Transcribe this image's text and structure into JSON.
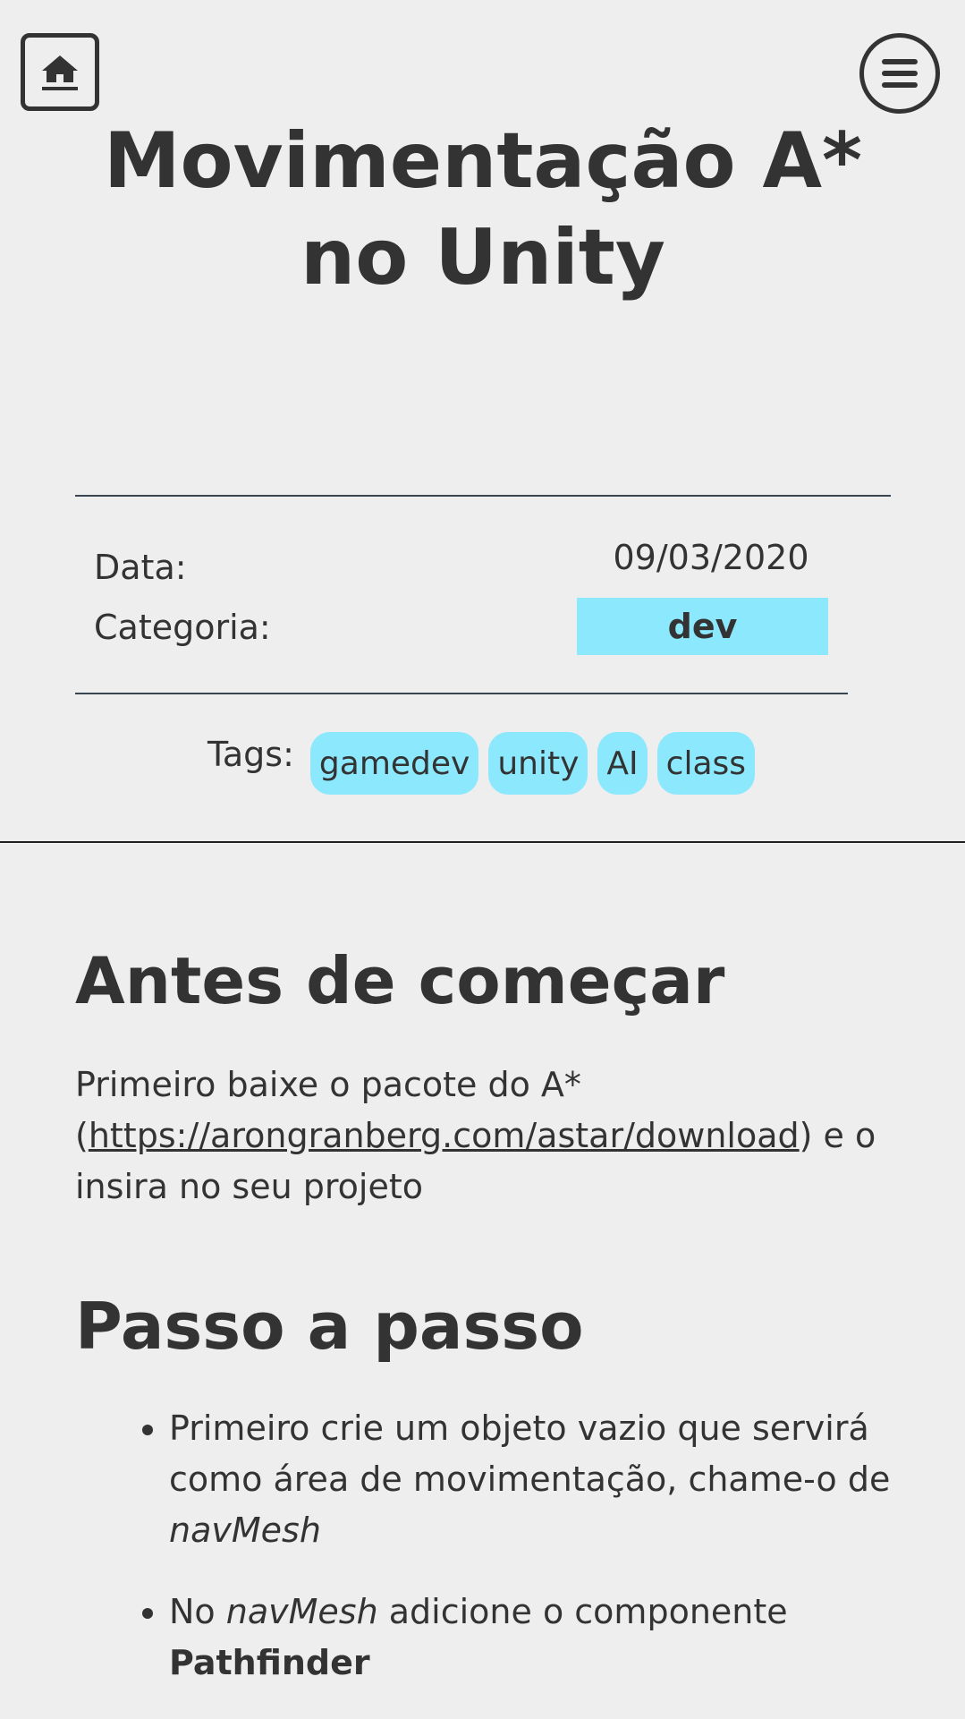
{
  "header": {
    "home_icon": "home-icon",
    "menu_icon": "menu-icon"
  },
  "post": {
    "title": "Movimentação A* no Unity",
    "meta": {
      "date_label": "Data:",
      "date_value": "09/03/2020",
      "category_label": "Categoria:",
      "category_value": "dev"
    },
    "tags_label": "Tags:",
    "tags": [
      "gamedev",
      "unity",
      "AI",
      "class"
    ]
  },
  "sections": {
    "before": {
      "heading": "Antes de começar",
      "text_before": "Primeiro baixe o pacote do A* (",
      "link": "https://arongranberg.com/astar/download",
      "text_after": ") e o insira no seu projeto"
    },
    "steps": {
      "heading": "Passo a passo",
      "item1_text": "Primeiro crie um objeto vazio que servirá como área de movimentação, chame-o de ",
      "item1_em": "navMesh",
      "item2_pre": "No ",
      "item2_em": "navMesh",
      "item2_mid": " adicione o componente ",
      "item2_strong": "Pathfinder"
    }
  },
  "colors": {
    "background": "#eeeeef",
    "text": "#333333",
    "badge": "#8ce8fc"
  }
}
